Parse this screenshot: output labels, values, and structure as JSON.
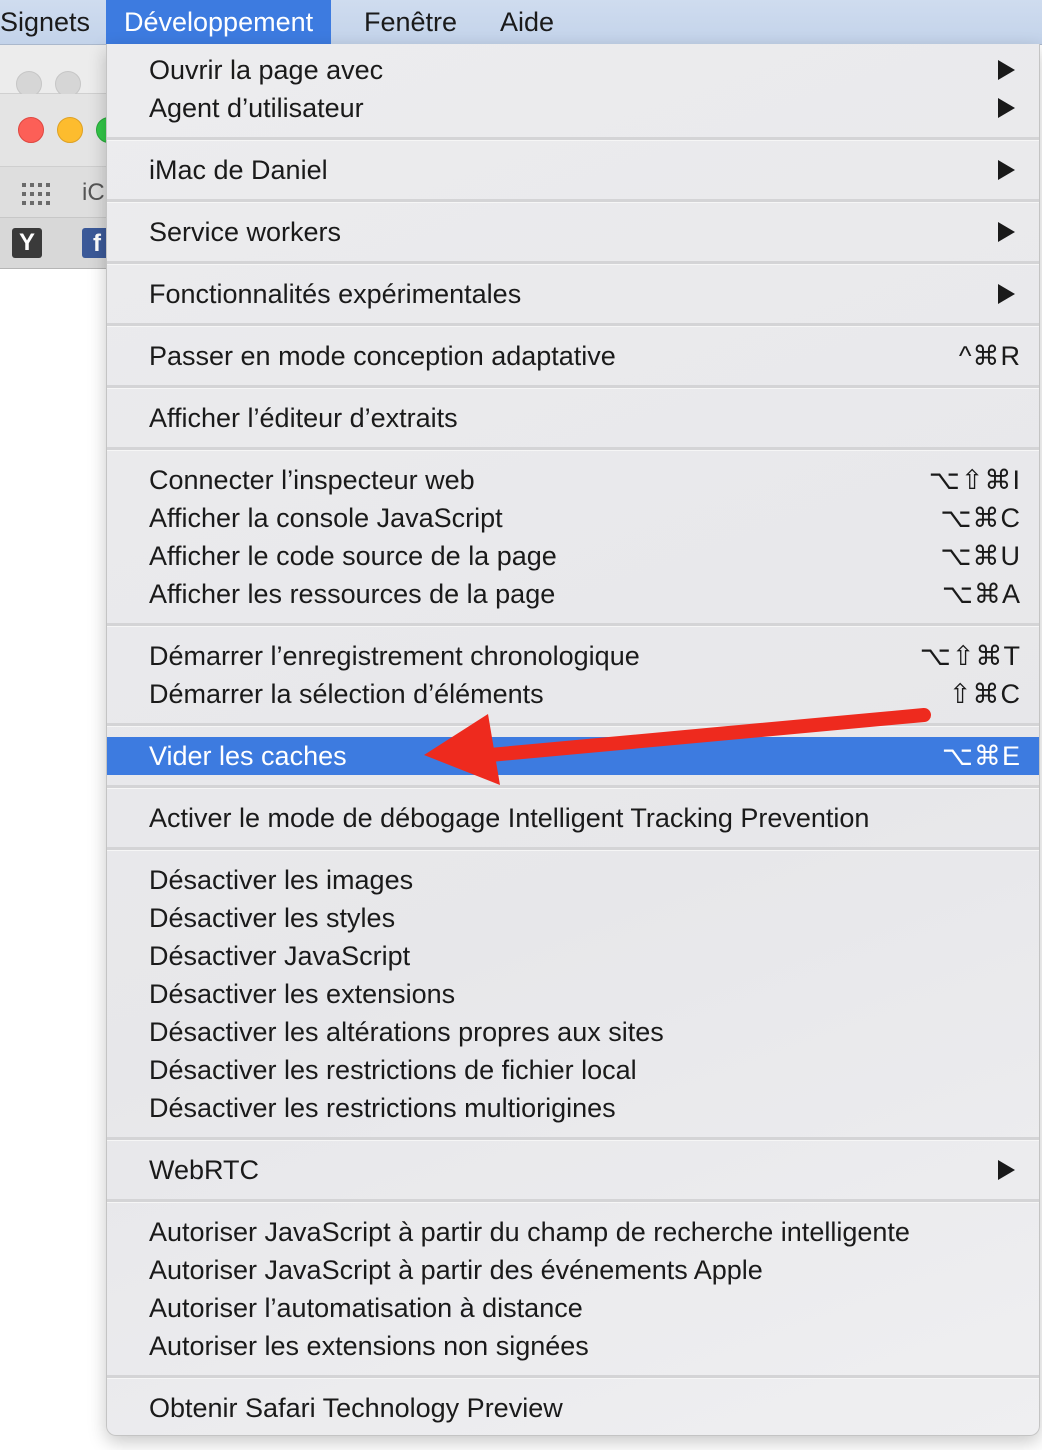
{
  "menubar": {
    "items": [
      {
        "label": "Signets"
      },
      {
        "label": "Développement"
      },
      {
        "label": "Fenêtre"
      },
      {
        "label": "Aide"
      }
    ],
    "active_index": 1
  },
  "background_window": {
    "tab_text": "iC",
    "bookmark_y": "Y",
    "bookmark_f": "f"
  },
  "menu": {
    "items": [
      {
        "label": "Ouvrir la page avec",
        "submenu": true
      },
      {
        "label": "Agent d’utilisateur",
        "submenu": true
      },
      {
        "label": "iMac de Daniel",
        "submenu": true
      },
      {
        "label": "Service workers",
        "submenu": true
      },
      {
        "label": "Fonctionnalités expérimentales",
        "submenu": true
      },
      {
        "label": "Passer en mode conception adaptative",
        "shortcut": "^⌘R"
      },
      {
        "label": "Afficher l’éditeur d’extraits"
      },
      {
        "label": "Connecter l’inspecteur web",
        "shortcut": "⌥⇧⌘I"
      },
      {
        "label": "Afficher la console JavaScript",
        "shortcut": "⌥⌘C"
      },
      {
        "label": "Afficher le code source de la page",
        "shortcut": "⌥⌘U"
      },
      {
        "label": "Afficher les ressources de la page",
        "shortcut": "⌥⌘A"
      },
      {
        "label": "Démarrer l’enregistrement chronologique",
        "shortcut": "⌥⇧⌘T"
      },
      {
        "label": "Démarrer la sélection d’éléments",
        "shortcut": "⇧⌘C"
      },
      {
        "label": "Vider les caches",
        "shortcut": "⌥⌘E",
        "highlighted": true
      },
      {
        "label": "Activer le mode de débogage Intelligent Tracking Prevention"
      },
      {
        "label": "Désactiver les images"
      },
      {
        "label": "Désactiver les styles"
      },
      {
        "label": "Désactiver JavaScript"
      },
      {
        "label": "Désactiver les extensions"
      },
      {
        "label": "Désactiver les altérations propres aux sites"
      },
      {
        "label": "Désactiver les restrictions de fichier local"
      },
      {
        "label": "Désactiver les restrictions multiorigines"
      },
      {
        "label": "WebRTC",
        "submenu": true
      },
      {
        "label": "Autoriser JavaScript à partir du champ de recherche intelligente"
      },
      {
        "label": "Autoriser JavaScript à partir des événements Apple"
      },
      {
        "label": "Autoriser l’automatisation à distance"
      },
      {
        "label": "Autoriser les extensions non signées"
      },
      {
        "label": "Obtenir Safari Technology Preview"
      }
    ]
  },
  "colors": {
    "highlight": "#3d7be0",
    "annotation_arrow": "#ee2a1e"
  }
}
